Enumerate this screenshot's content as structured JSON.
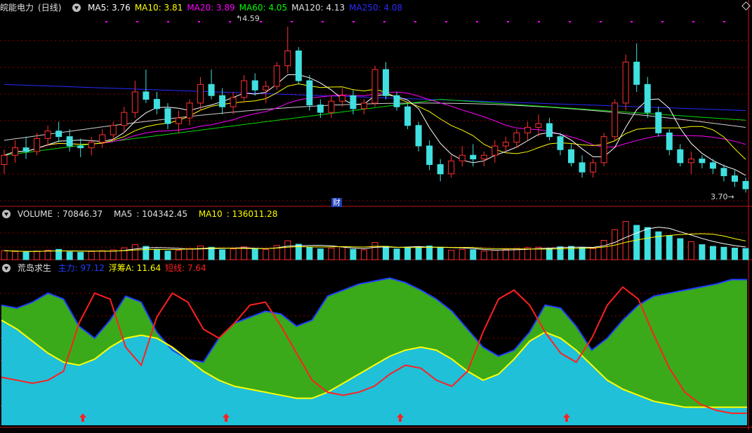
{
  "stock": {
    "name": "皖能电力",
    "period": "(日线)"
  },
  "ma": [
    {
      "label": "MA5",
      "value": "3.76",
      "color": "#ffffff"
    },
    {
      "label": "MA10",
      "value": "3.81",
      "color": "#ffff00"
    },
    {
      "label": "MA20",
      "value": "3.89",
      "color": "#ff00ff"
    },
    {
      "label": "MA60",
      "value": "4.05",
      "color": "#00ff00"
    },
    {
      "label": "MA120",
      "value": "4.13",
      "color": "#e0e0e0"
    },
    {
      "label": "MA250",
      "value": "4.08",
      "color": "#2a2aff"
    }
  ],
  "price_high_label": "4.59",
  "price_low_label": "3.70",
  "finance_marker": "财",
  "volume": {
    "label": "VOLUME",
    "value": "70846.37",
    "ma5_label": "MA5",
    "ma5": "104342.45",
    "ma10_label": "MA10",
    "ma10": "136011.28"
  },
  "indicator": {
    "name": "荒岛求生",
    "lines": [
      {
        "label": "主力",
        "value": "97.12",
        "color": "#1f3fff"
      },
      {
        "label": "浮筹A",
        "value": "11.64",
        "color": "#ffff00"
      },
      {
        "label": "短线",
        "value": "7.64",
        "color": "#ff2020"
      }
    ]
  },
  "colors": {
    "up": "#ff3030",
    "down": "#40e0e0",
    "grid": "#8b0000",
    "green_fill": "#3aaa1a",
    "cyan_fill": "#20c0d8"
  },
  "chart_data": {
    "type": "line",
    "title": "皖能电力 (日线)",
    "price_candles": [
      [
        3.85,
        3.93,
        3.8,
        3.9
      ],
      [
        3.9,
        3.98,
        3.86,
        3.94
      ],
      [
        3.94,
        4.0,
        3.88,
        3.92
      ],
      [
        3.92,
        4.02,
        3.9,
        3.99
      ],
      [
        3.99,
        4.06,
        3.95,
        4.03
      ],
      [
        4.03,
        4.08,
        3.97,
        4.0
      ],
      [
        4.0,
        4.04,
        3.92,
        3.95
      ],
      [
        3.95,
        3.99,
        3.89,
        3.94
      ],
      [
        3.94,
        4.0,
        3.9,
        3.97
      ],
      [
        3.97,
        4.04,
        3.94,
        4.01
      ],
      [
        4.01,
        4.08,
        3.98,
        4.06
      ],
      [
        4.06,
        4.16,
        4.02,
        4.13
      ],
      [
        4.13,
        4.3,
        4.1,
        4.24
      ],
      [
        4.24,
        4.36,
        4.18,
        4.2
      ],
      [
        4.2,
        4.24,
        4.12,
        4.15
      ],
      [
        4.15,
        4.18,
        4.04,
        4.07
      ],
      [
        4.07,
        4.14,
        4.02,
        4.1
      ],
      [
        4.1,
        4.2,
        4.06,
        4.18
      ],
      [
        4.18,
        4.32,
        4.14,
        4.28
      ],
      [
        4.28,
        4.36,
        4.2,
        4.22
      ],
      [
        4.22,
        4.26,
        4.12,
        4.16
      ],
      [
        4.16,
        4.24,
        4.12,
        4.21
      ],
      [
        4.21,
        4.33,
        4.18,
        4.3
      ],
      [
        4.3,
        4.34,
        4.22,
        4.25
      ],
      [
        4.25,
        4.3,
        4.18,
        4.27
      ],
      [
        4.27,
        4.4,
        4.25,
        4.38
      ],
      [
        4.38,
        4.59,
        4.34,
        4.46
      ],
      [
        4.46,
        4.48,
        4.28,
        4.3
      ],
      [
        4.3,
        4.33,
        4.14,
        4.17
      ],
      [
        4.17,
        4.2,
        4.1,
        4.13
      ],
      [
        4.13,
        4.22,
        4.1,
        4.19
      ],
      [
        4.19,
        4.26,
        4.16,
        4.22
      ],
      [
        4.22,
        4.25,
        4.12,
        4.15
      ],
      [
        4.15,
        4.2,
        4.12,
        4.18
      ],
      [
        4.18,
        4.38,
        4.16,
        4.36
      ],
      [
        4.36,
        4.4,
        4.2,
        4.22
      ],
      [
        4.22,
        4.24,
        4.14,
        4.16
      ],
      [
        4.16,
        4.18,
        4.04,
        4.06
      ],
      [
        4.06,
        4.08,
        3.92,
        3.95
      ],
      [
        3.95,
        3.98,
        3.82,
        3.85
      ],
      [
        3.85,
        3.88,
        3.76,
        3.8
      ],
      [
        3.8,
        3.9,
        3.78,
        3.87
      ],
      [
        3.87,
        3.95,
        3.84,
        3.9
      ],
      [
        3.9,
        3.96,
        3.84,
        3.88
      ],
      [
        3.88,
        3.92,
        3.84,
        3.9
      ],
      [
        3.9,
        3.98,
        3.86,
        3.95
      ],
      [
        3.95,
        4.0,
        3.92,
        3.97
      ],
      [
        3.97,
        4.04,
        3.94,
        4.02
      ],
      [
        4.02,
        4.08,
        3.98,
        4.05
      ],
      [
        4.05,
        4.12,
        4.0,
        4.07
      ],
      [
        4.07,
        4.1,
        3.98,
        4.0
      ],
      [
        4.0,
        4.02,
        3.9,
        3.93
      ],
      [
        3.93,
        3.96,
        3.84,
        3.86
      ],
      [
        3.86,
        3.9,
        3.78,
        3.81
      ],
      [
        3.81,
        3.88,
        3.78,
        3.86
      ],
      [
        3.86,
        4.02,
        3.84,
        4.0
      ],
      [
        4.0,
        4.2,
        3.98,
        4.18
      ],
      [
        4.18,
        4.44,
        4.14,
        4.4
      ],
      [
        4.4,
        4.5,
        4.24,
        4.28
      ],
      [
        4.28,
        4.32,
        4.1,
        4.13
      ],
      [
        4.13,
        4.16,
        4.0,
        4.02
      ],
      [
        4.02,
        4.04,
        3.9,
        3.93
      ],
      [
        3.93,
        3.96,
        3.84,
        3.86
      ],
      [
        3.86,
        3.92,
        3.8,
        3.88
      ],
      [
        3.88,
        3.9,
        3.83,
        3.86
      ],
      [
        3.86,
        3.88,
        3.8,
        3.83
      ],
      [
        3.83,
        3.85,
        3.76,
        3.79
      ],
      [
        3.79,
        3.82,
        3.73,
        3.76
      ],
      [
        3.76,
        3.78,
        3.7,
        3.72
      ]
    ],
    "volume_bars": [
      42,
      38,
      35,
      40,
      44,
      48,
      36,
      34,
      38,
      42,
      46,
      55,
      70,
      62,
      48,
      40,
      44,
      52,
      64,
      58,
      46,
      50,
      60,
      52,
      48,
      66,
      88,
      72,
      58,
      50,
      54,
      60,
      48,
      46,
      80,
      62,
      50,
      56,
      60,
      64,
      58,
      44,
      48,
      46,
      40,
      44,
      48,
      52,
      56,
      58,
      54,
      60,
      62,
      58,
      52,
      90,
      140,
      178,
      160,
      150,
      130,
      112,
      98,
      84,
      70,
      62,
      58,
      54,
      52
    ],
    "series": [
      {
        "name": "主力",
        "values": [
          80,
          78,
          82,
          88,
          84,
          66,
          58,
          70,
          86,
          82,
          62,
          50,
          44,
          42,
          58,
          68,
          72,
          76,
          74,
          66,
          70,
          86,
          90,
          94,
          96,
          98,
          95,
          90,
          84,
          76,
          64,
          52,
          46,
          50,
          62,
          80,
          78,
          66,
          50,
          58,
          70,
          80,
          86,
          88,
          90,
          92,
          94,
          97,
          97
        ]
      },
      {
        "name": "浮筹A",
        "values": [
          70,
          64,
          56,
          48,
          42,
          40,
          44,
          52,
          58,
          60,
          58,
          52,
          44,
          36,
          30,
          26,
          24,
          22,
          20,
          18,
          18,
          22,
          28,
          34,
          40,
          46,
          50,
          52,
          50,
          44,
          36,
          30,
          34,
          44,
          56,
          62,
          58,
          50,
          40,
          30,
          24,
          20,
          16,
          14,
          12,
          12,
          12,
          12,
          12
        ]
      },
      {
        "name": "短线",
        "values": [
          32,
          30,
          28,
          30,
          36,
          68,
          88,
          84,
          52,
          40,
          72,
          88,
          82,
          64,
          58,
          68,
          80,
          82,
          66,
          48,
          30,
          22,
          20,
          22,
          26,
          34,
          40,
          38,
          30,
          26,
          36,
          62,
          84,
          90,
          80,
          62,
          48,
          42,
          58,
          80,
          92,
          84,
          60,
          38,
          22,
          14,
          10,
          8,
          8
        ]
      }
    ]
  }
}
